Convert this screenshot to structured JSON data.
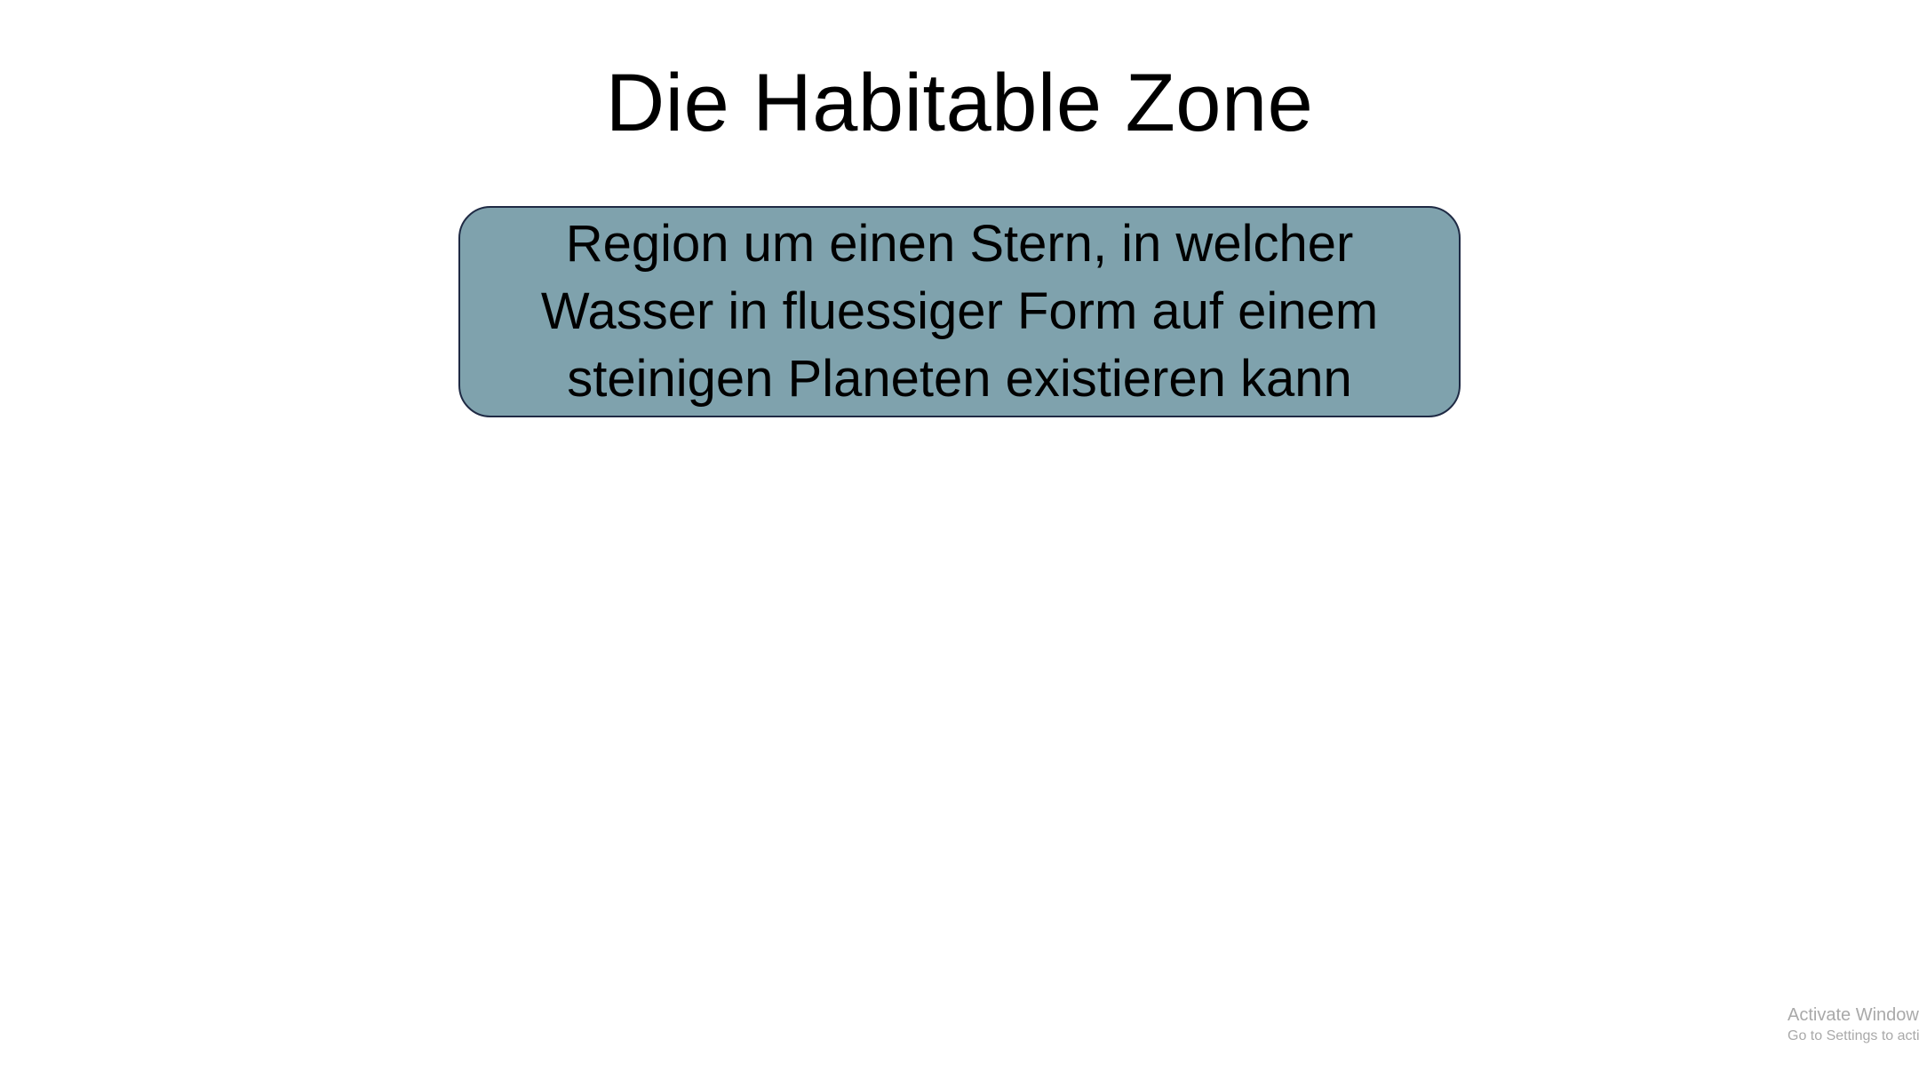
{
  "colors": {
    "background": "#ffffff",
    "box_fill": "#7fa2ad",
    "box_border": "#1f2a44",
    "text": "#000000",
    "watermark_text": "#a9a9a9"
  },
  "slide": {
    "title": "Die Habitable Zone",
    "definition": "Region um einen Stern, in welcher Wasser in fluessiger Form auf einem steinigen Planeten existieren kann"
  },
  "watermark": {
    "line1": "Activate Window",
    "line2": "Go to Settings to activ"
  }
}
